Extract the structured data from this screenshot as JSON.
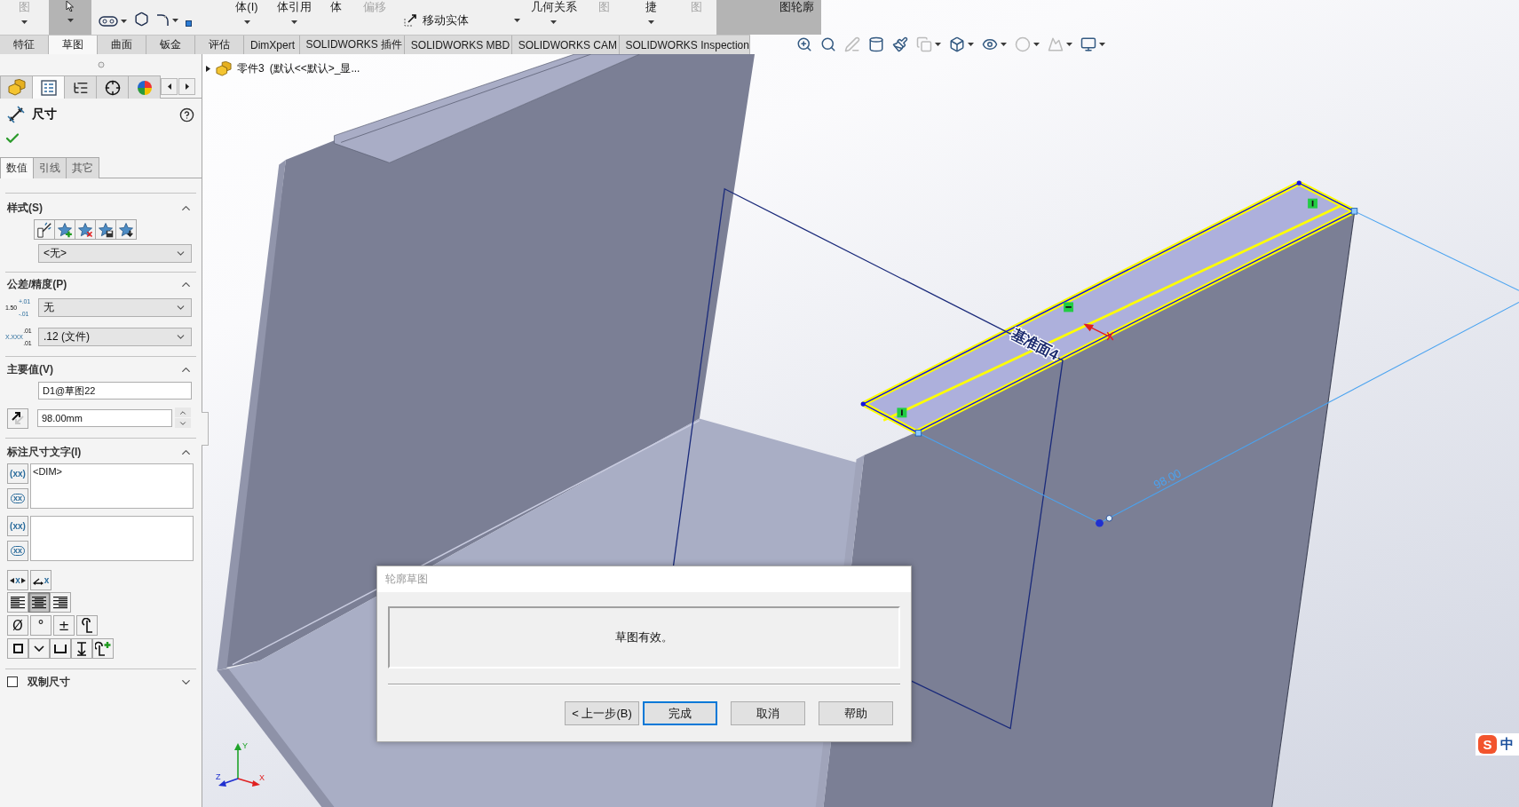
{
  "command_toolbar": {
    "items": [
      {
        "kind": "text",
        "label": "图",
        "pressed": false,
        "disabled": true,
        "menu": true
      },
      {
        "kind": "select",
        "pressed": true,
        "disabled": false,
        "menu": true
      },
      {
        "kind": "sketch",
        "pressed": false,
        "disabled": false,
        "menu": true
      },
      {
        "kind": "text",
        "label": "体(I)",
        "pressed": false,
        "disabled": false,
        "menu": true
      },
      {
        "kind": "text",
        "label": "体引用",
        "pressed": false,
        "disabled": false,
        "menu": true
      },
      {
        "kind": "text",
        "label": "体",
        "pressed": false,
        "disabled": false,
        "menu": false
      },
      {
        "kind": "text",
        "label": "偏移",
        "pressed": false,
        "disabled": true,
        "menu": false
      },
      {
        "kind": "move",
        "label": "移动实体",
        "pressed": false,
        "disabled": false,
        "menu": true
      },
      {
        "kind": "text",
        "label": "几何关系",
        "pressed": false,
        "disabled": false,
        "menu": true
      },
      {
        "kind": "text",
        "label": "图",
        "pressed": false,
        "disabled": true,
        "menu": false
      },
      {
        "kind": "text",
        "label": "捷",
        "pressed": false,
        "disabled": false,
        "menu": true
      },
      {
        "kind": "text",
        "label": "图",
        "pressed": false,
        "disabled": true,
        "menu": false
      },
      {
        "kind": "blank",
        "pressed": true,
        "disabled": false,
        "menu": false
      },
      {
        "kind": "text",
        "label": "图轮廓",
        "pressed": true,
        "disabled": false,
        "menu": false
      }
    ]
  },
  "tabs": [
    {
      "label": "特征",
      "selected": false
    },
    {
      "label": "草图",
      "selected": true
    },
    {
      "label": "曲面",
      "selected": false
    },
    {
      "label": "钣金",
      "selected": false
    },
    {
      "label": "评估",
      "selected": false
    },
    {
      "label": "DimXpert",
      "selected": false
    },
    {
      "label": "SOLIDWORKS 插件",
      "selected": false
    },
    {
      "label": "SOLIDWORKS MBD",
      "selected": false
    },
    {
      "label": "SOLIDWORKS CAM",
      "selected": false
    },
    {
      "label": "SOLIDWORKS Inspection",
      "selected": false
    }
  ],
  "view_toolbar": [
    {
      "disabled": false,
      "menu": false
    },
    {
      "disabled": false,
      "menu": false
    },
    {
      "disabled": true,
      "menu": false
    },
    {
      "disabled": false,
      "menu": false
    },
    {
      "disabled": false,
      "menu": false
    },
    {
      "disabled": true,
      "menu": true
    },
    {
      "disabled": false,
      "menu": true
    },
    {
      "disabled": false,
      "menu": true
    },
    {
      "disabled": true,
      "menu": true
    },
    {
      "disabled": true,
      "menu": true
    },
    {
      "disabled": false,
      "menu": true
    }
  ],
  "property_manager": {
    "tabs": [
      {
        "selected": false
      },
      {
        "selected": true
      },
      {
        "selected": false
      },
      {
        "selected": false
      },
      {
        "selected": false
      }
    ],
    "title": "尺寸",
    "subtabs": [
      {
        "label": "数值",
        "selected": true
      },
      {
        "label": "引线",
        "selected": false
      },
      {
        "label": "其它",
        "selected": false
      }
    ],
    "style": {
      "title": "样式(S)",
      "expanded": true,
      "value": "<无>"
    },
    "tolerance": {
      "title": "公差/精度(P)",
      "expanded": true,
      "tolerance_sample": [
        "+.01",
        "1.50",
        "-.01"
      ],
      "tolerance_value": "无",
      "precision_sample": [
        ".01",
        "X.XXX",
        ".01"
      ],
      "precision_value": ".12 (文件)"
    },
    "primary_value": {
      "title": "主要值(V)",
      "expanded": true,
      "name": "D1@草图22",
      "value": "98.00mm"
    },
    "dimension_text": {
      "title": "标注尺寸文字(I)",
      "expanded": true,
      "field_buttons": [
        {
          "kind": "paren",
          "label": "(xx)"
        },
        {
          "kind": "box",
          "label": "xx"
        },
        {
          "kind": "paren",
          "label": "(xx)"
        },
        {
          "kind": "box",
          "label": "xx"
        }
      ],
      "upper_text": "<DIM>",
      "placement_buttons": [
        {
          "kind": "between",
          "label": "x"
        },
        {
          "kind": "angled",
          "label": "x"
        }
      ],
      "align_buttons": [
        {
          "selected": false
        },
        {
          "selected": true
        },
        {
          "selected": false
        }
      ],
      "symbols": [
        "Ø",
        "°",
        "±"
      ]
    },
    "dual_dimension": {
      "label": "双制尺寸",
      "checked": false,
      "expanded": false
    }
  },
  "viewport": {
    "tree": {
      "expanded": false,
      "part": "零件3",
      "config": "(默认<<默认>_显..."
    },
    "plane_label": "基准面4",
    "dimension_value": "98.00",
    "triad": [
      "Y",
      "X",
      "Z"
    ],
    "dialog": {
      "title": "轮廓草图",
      "message": "草图有效。",
      "buttons": [
        {
          "label": "< 上一步(B)",
          "default": false
        },
        {
          "label": "完成",
          "default": true
        },
        {
          "label": "取消",
          "default": false
        },
        {
          "label": "帮助",
          "default": false
        }
      ]
    },
    "ime": {
      "logo": "S",
      "mode": "中"
    }
  }
}
